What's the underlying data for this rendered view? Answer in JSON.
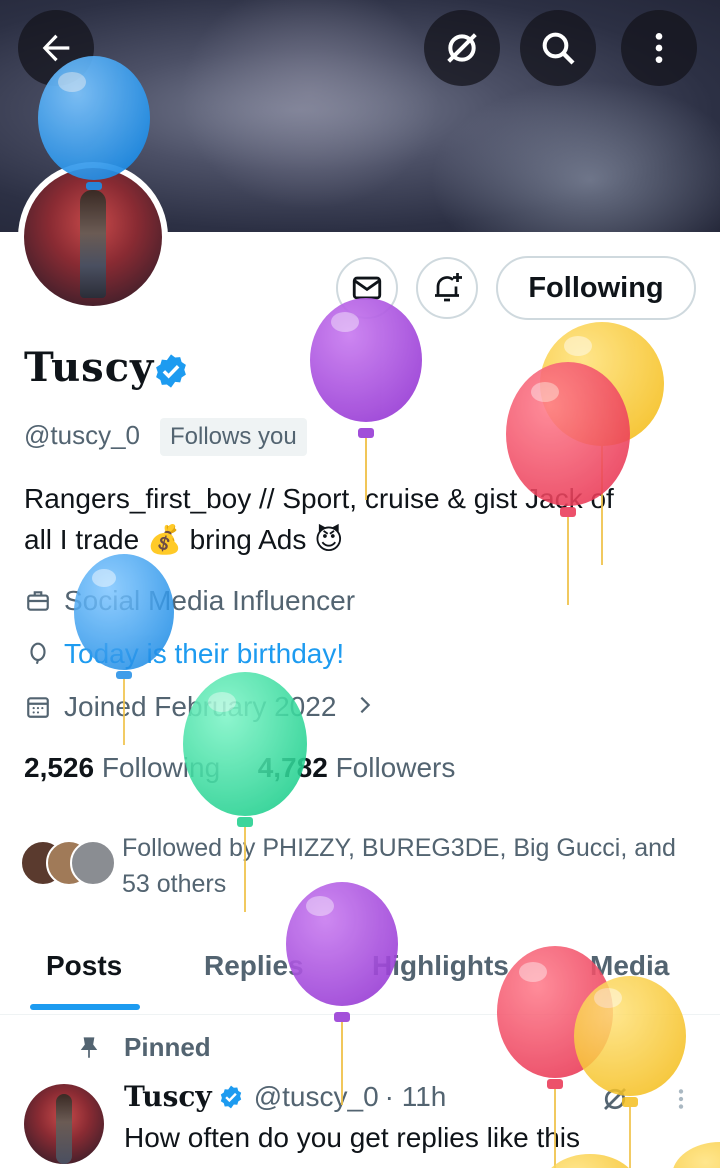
{
  "header": {
    "back_icon": "arrow-left-icon",
    "grok_icon": "slash-circle-icon",
    "search_icon": "search-icon",
    "more_icon": "more-vertical-icon"
  },
  "profile": {
    "name": "Tuscy",
    "handle": "@tuscy_0",
    "follows_you": "Follows you",
    "bio_line1": "Rangers_first_boy // Sport, cruise & gist Jack of",
    "bio_line2_a": "all I trade",
    "bio_emoji1": "💰",
    "bio_line2_b": "bring Ads",
    "bio_emoji2": "😈",
    "category": "Social Media Influencer",
    "birthday": "Today is their birthday!",
    "joined": "Joined February 2022",
    "following_count": "2,526",
    "following_label": "Following",
    "followers_count": "4,782",
    "followers_label": "Followers",
    "followed_by": "Followed by PHIZZY, BUREG3DE, Big Gucci, and 53 others"
  },
  "actions": {
    "message_icon": "mail-icon",
    "notify_icon": "bell-plus-icon",
    "following_label": "Following"
  },
  "tabs": [
    "Posts",
    "Replies",
    "Highlights",
    "Media"
  ],
  "pinned_post": {
    "pinned_label": "Pinned",
    "author": "Tuscy",
    "handle": "@tuscy_0",
    "time": "· 11h",
    "text": "How often do you get replies like this"
  },
  "colors": {
    "accent": "#1d9bf0",
    "text": "#0f1419",
    "muted": "#536471"
  }
}
